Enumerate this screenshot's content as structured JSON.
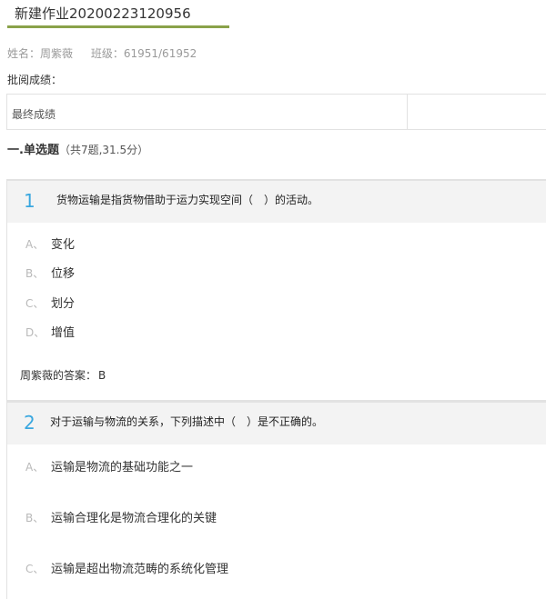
{
  "page": {
    "title": "新建作业20200223120956",
    "student": {
      "name": "姓名：周紫薇",
      "class": "班级：61951/61952"
    },
    "review_label": "批阅成绩：",
    "final_grade_label": "最终成绩",
    "section": {
      "title": "一.单选题",
      "meta": "（共7题,31.5分）"
    },
    "colors": {
      "accent_green": "#8aa24a",
      "question_number_blue": "#3aa7df"
    }
  },
  "questions": [
    {
      "number": "1",
      "text": "货物运输是指货物借助于运力实现空间（　）的活动。",
      "options": [
        {
          "letter": "A、",
          "text": "变化"
        },
        {
          "letter": "B、",
          "text": "位移"
        },
        {
          "letter": "C、",
          "text": "划分"
        },
        {
          "letter": "D、",
          "text": "增值"
        }
      ],
      "answer_label": "周紫薇的答案：",
      "answer": "B"
    },
    {
      "number": "2",
      "text": "对于运输与物流的关系，下列描述中（　）是不正确的。",
      "options": [
        {
          "letter": "A、",
          "text": "运输是物流的基础功能之一"
        },
        {
          "letter": "B、",
          "text": "运输合理化是物流合理化的关键"
        },
        {
          "letter": "C、",
          "text": "运输是超出物流范畴的系统化管理"
        }
      ]
    }
  ]
}
